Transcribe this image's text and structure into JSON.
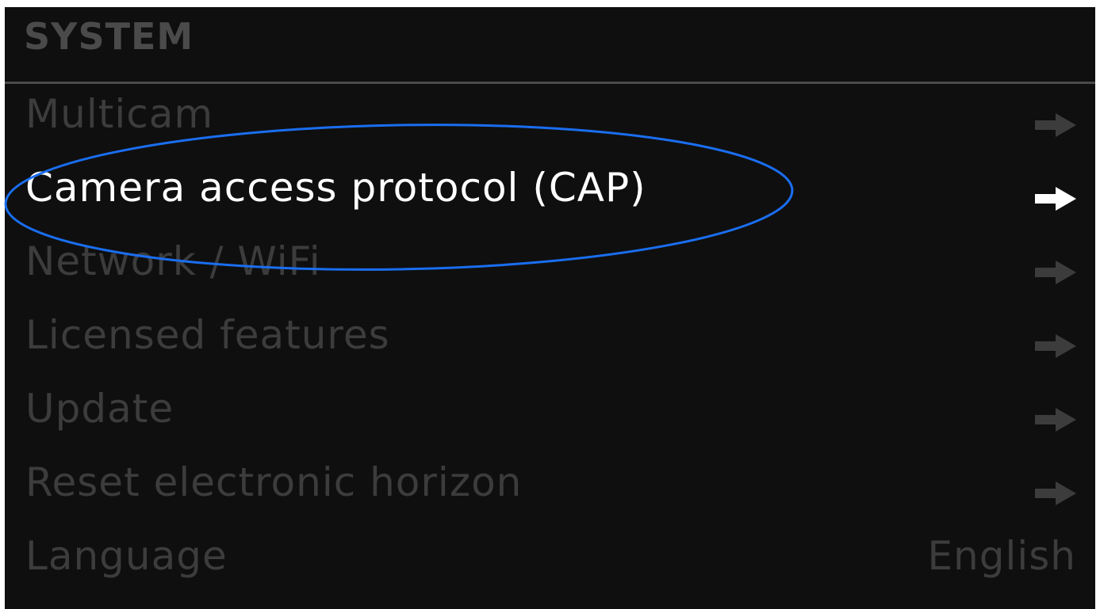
{
  "header": {
    "title": "SYSTEM"
  },
  "menu": {
    "items": [
      {
        "label": "Multicam",
        "icon": "arrow-right-icon"
      },
      {
        "label": "Camera access protocol (CAP)",
        "icon": "arrow-right-icon",
        "selected": true
      },
      {
        "label": "Network / WiFi",
        "icon": "arrow-right-icon"
      },
      {
        "label": "Licensed features",
        "icon": "arrow-right-icon"
      },
      {
        "label": "Update",
        "icon": "arrow-right-icon"
      },
      {
        "label": "Reset electronic horizon",
        "icon": "arrow-right-icon"
      },
      {
        "label": "Language",
        "value": "English"
      }
    ]
  },
  "colors": {
    "background": "#0f0f0f",
    "inactive_text": "#3c3c3c",
    "selected_text": "#ffffff",
    "header_text": "#4a4a4a",
    "annotation": "#1a6ef0"
  }
}
